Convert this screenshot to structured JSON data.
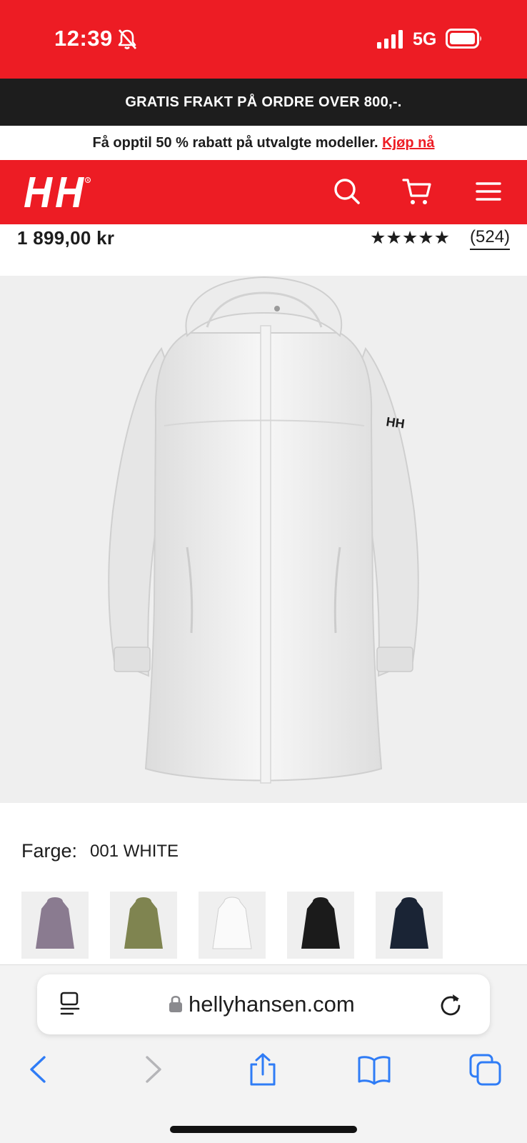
{
  "status_bar": {
    "time": "12:39",
    "network": "5G"
  },
  "promo_bar": {
    "text": "GRATIS FRAKT PÅ ORDRE OVER 800,-."
  },
  "sale_banner": {
    "text": "Få opptil 50 % rabatt på utvalgte modeller.",
    "link": "Kjøp nå"
  },
  "header": {
    "icons": [
      "hh-logo",
      "search-icon",
      "cart-icon",
      "menu-icon"
    ]
  },
  "product": {
    "price": "1 899,00 kr",
    "rating_stars": "★★★★★",
    "rating": 5,
    "review_count": "(524)",
    "image_dots": {
      "count": 2,
      "active": 0
    },
    "color_label": "Farge:",
    "color_value": "001 WHITE",
    "swatches": [
      {
        "color": "#8a7b90",
        "selected": false
      },
      {
        "color": "#7f8450",
        "selected": false
      },
      {
        "color": "#f2f2f2",
        "selected": true
      },
      {
        "color": "#1b1b1b",
        "selected": false
      },
      {
        "color": "#1a2435",
        "selected": false
      }
    ]
  },
  "browser": {
    "url": "hellyhansen.com",
    "icons": [
      "reader-icon",
      "lock-icon",
      "reload-icon",
      "back-icon",
      "forward-icon",
      "share-icon",
      "bookmarks-icon",
      "tabs-icon"
    ]
  },
  "colors": {
    "brand_red": "#ed1c24",
    "dark": "#1d1d1d",
    "safari_blue": "#2f7cf6"
  }
}
